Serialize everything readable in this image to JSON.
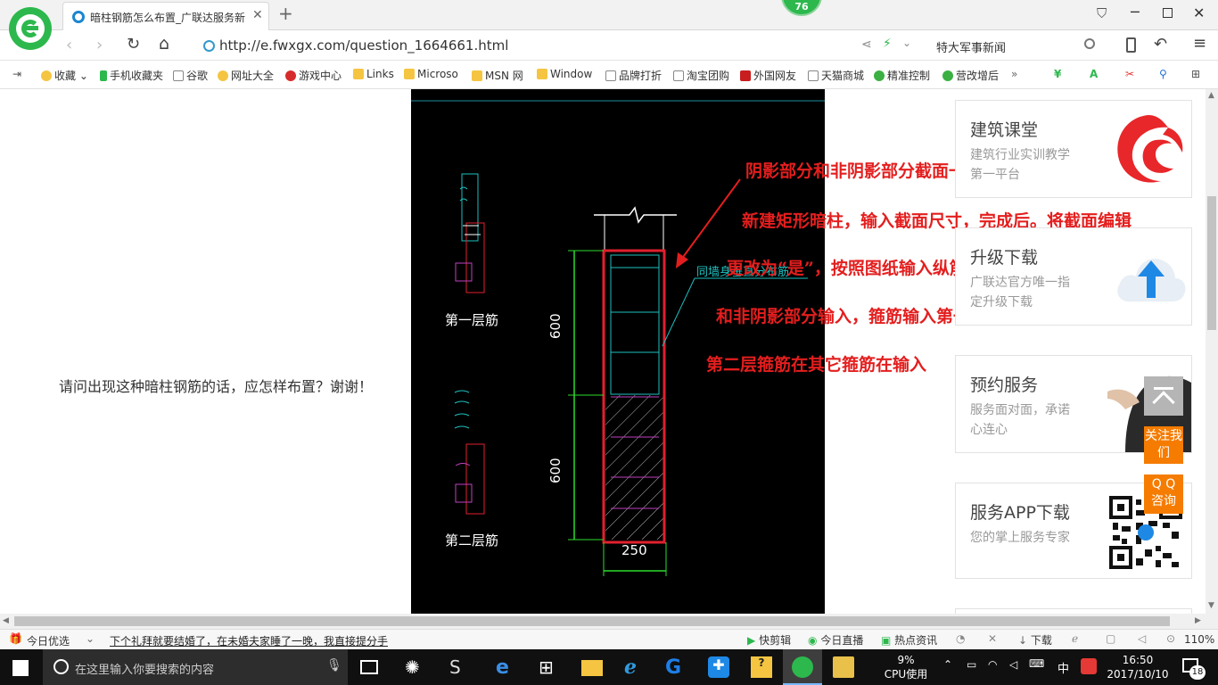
{
  "browser": {
    "badge": "76",
    "tab_title": "暗柱钢筋怎么布置_广联达服务新",
    "new_tab": "+",
    "url": "http://e.fwxgx.com/question_1664661.html",
    "search_text": "特大军事新闻"
  },
  "bookmarks": [
    "收藏",
    "手机收藏夹",
    "谷歌",
    "网址大全",
    "游戏中心",
    "Links",
    "Microso",
    "MSN 网",
    "Window",
    "品牌打折",
    "淘宝团购",
    "外国网友",
    "天猫商城",
    "精准控制",
    "营改增后"
  ],
  "bookmarks_more": "»",
  "question_text": "请问出现这种暗柱钢筋的话，应怎样布置？谢谢！",
  "drawing": {
    "layer1_label": "第一层筋",
    "layer2_label": "第二层筋",
    "dim_top": "600",
    "dim_bottom": "600",
    "dim_width": "250",
    "callout": "同墙身垂直分布筋"
  },
  "annotations": [
    "阴影部分和非阴影部分截面一起定义暗柱",
    "新建矩形暗柱，输入截面尺寸，完成后。将截面编辑",
    "更改为“是”，按照图纸输入纵筋，按照阴影bf",
    "和非阴影部分输入，箍筋输入第一层箍筋",
    "第二层箍筋在其它箍筋在输入"
  ],
  "sidebar": [
    {
      "title": "建筑课堂",
      "sub": "建筑行业实训教学第一平台"
    },
    {
      "title": "升级下载",
      "sub": "广联达官方唯一指定升级下载"
    },
    {
      "title": "预约服务",
      "sub": "服务面对面，承诺心连心"
    },
    {
      "title": "服务APP下载",
      "sub": "您的掌上服务专家"
    }
  ],
  "float": {
    "follow": "关注我们",
    "qq": "Q Q 咨询"
  },
  "statusbar": {
    "today": "今日优选",
    "news": "下个礼拜就要结婚了，在未婚夫家睡了一晚，我直接提分手",
    "clip": "快剪辑",
    "live": "今日直播",
    "hot": "热点资讯",
    "download": "下载",
    "zoom": "110%"
  },
  "taskbar": {
    "search_placeholder": "在这里输入你要搜索的内容",
    "cpu": "9%",
    "cpu_label": "CPU使用",
    "ime": "中",
    "time": "16:50",
    "date": "2017/10/10",
    "notifications": "18"
  },
  "colors": {
    "accent_green": "#2db84d",
    "annotation_red": "#e41e1e",
    "float_orange": "#f57c00",
    "cad_bg": "#000000"
  }
}
